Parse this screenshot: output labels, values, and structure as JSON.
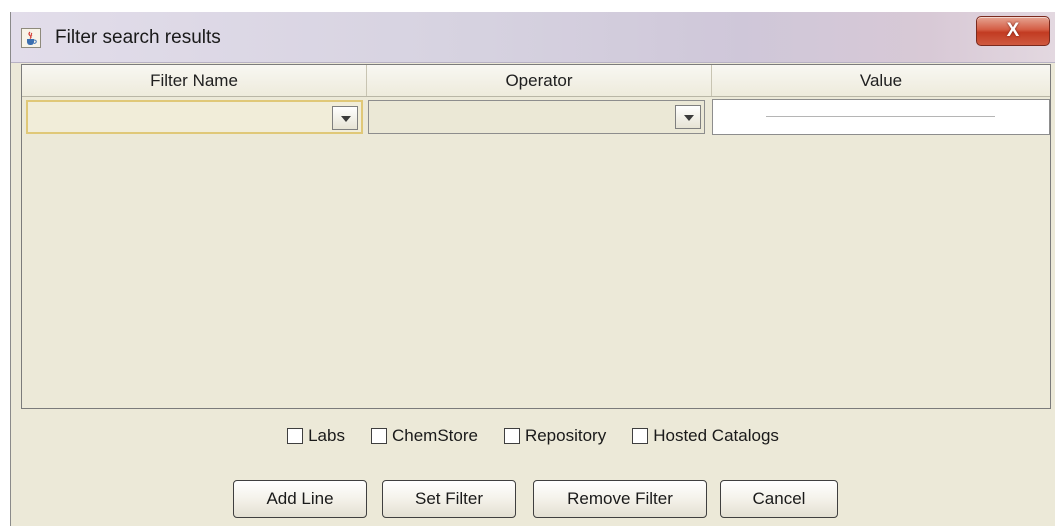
{
  "window": {
    "title": "Filter search results",
    "close_glyph": "X",
    "app_icon": "java-cup-icon",
    "colors": {
      "window_bg": "#ece9d8",
      "close_button": "#c23b22",
      "focus_border": "#e0c878"
    }
  },
  "grid": {
    "columns": [
      "Filter Name",
      "Operator",
      "Value"
    ],
    "row": {
      "filter_name": "",
      "operator": "",
      "value": ""
    }
  },
  "options": {
    "labs": {
      "label": "Labs",
      "checked": false
    },
    "chemstore": {
      "label": "ChemStore",
      "checked": false
    },
    "repository": {
      "label": "Repository",
      "checked": false
    },
    "hosted_catalogs": {
      "label": "Hosted Catalogs",
      "checked": false
    }
  },
  "buttons": {
    "add_line": "Add Line",
    "set_filter": "Set Filter",
    "remove_filter": "Remove Filter",
    "cancel": "Cancel"
  }
}
